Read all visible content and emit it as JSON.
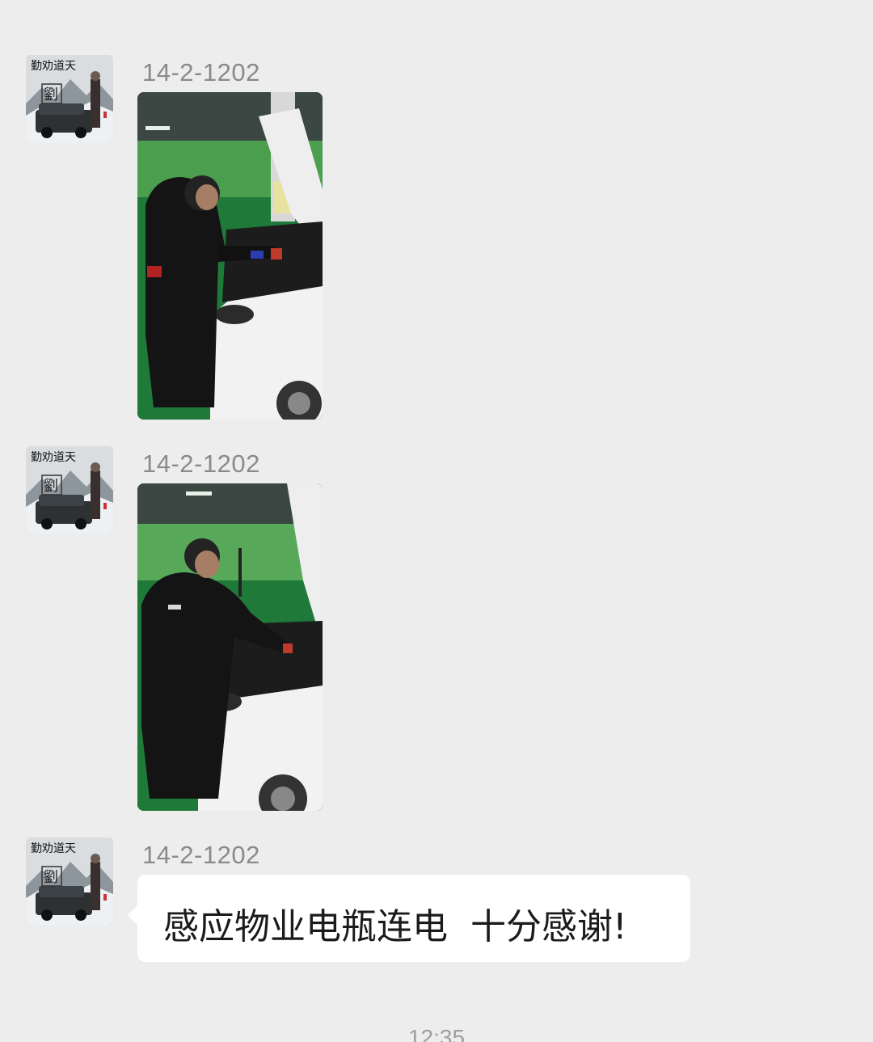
{
  "messages": [
    {
      "sender": "14-2-1202",
      "type": "image",
      "avatar_icon": "user-avatar-snow-car",
      "image_icon": "photo-man-jump-starting-car"
    },
    {
      "sender": "14-2-1202",
      "type": "image",
      "avatar_icon": "user-avatar-snow-car",
      "image_icon": "photo-man-jump-starting-car"
    },
    {
      "sender": "14-2-1202",
      "type": "text",
      "avatar_icon": "user-avatar-snow-car",
      "text": "感应物业电瓶连电  十分感谢!"
    }
  ],
  "timestamp": "12:35",
  "colors": {
    "background": "#ededed",
    "bubble": "#ffffff",
    "sender_name": "#8a8a8a"
  }
}
